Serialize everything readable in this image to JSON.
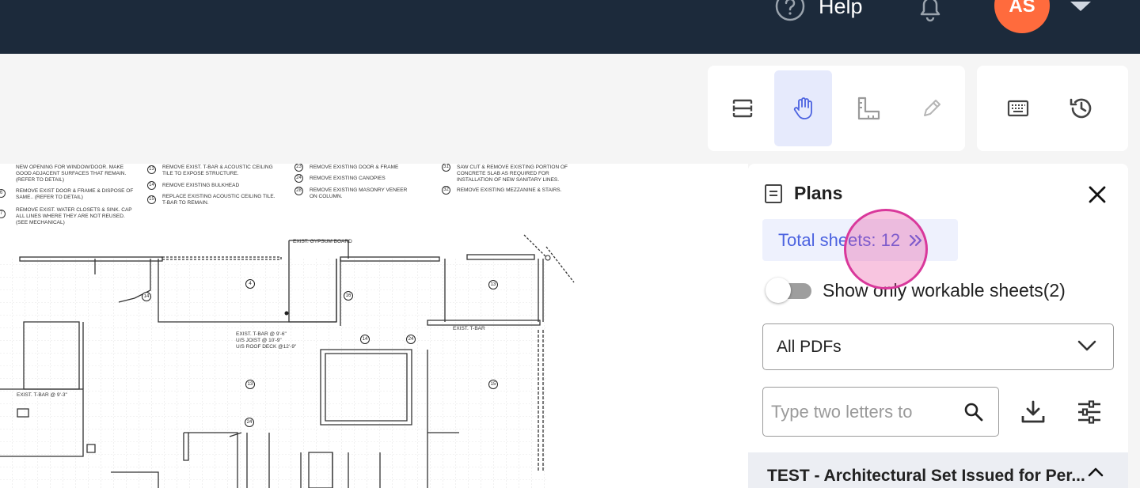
{
  "header": {
    "help_label": "Help",
    "avatar_initials": "AS",
    "colors": {
      "bar": "#1c2a3b",
      "avatar": "#ff6b3d"
    }
  },
  "toolbar": {
    "tools": [
      {
        "icon": "split-view-icon",
        "active": false
      },
      {
        "icon": "hand-pan-icon",
        "active": true
      },
      {
        "icon": "ruler-measure-icon",
        "active": false
      },
      {
        "icon": "pencil-markup-icon",
        "active": false
      }
    ],
    "side_tools": [
      {
        "icon": "keyboard-icon"
      },
      {
        "icon": "history-icon"
      }
    ]
  },
  "drawing": {
    "legend": [
      {
        "text": "NEW OPENING FOR WINDOW/DOOR. MAKE GOOD ADJACENT SURFACES THAT REMAIN.(REFER TO DETAIL)"
      },
      {
        "num": "6",
        "text": "REMOVE EXIST DOOR & FRAME & DISPOSE OF SAME.. (REFER TO DETAIL)"
      },
      {
        "num": "7",
        "text": "REMOVE EXIST. WATER CLOSETS & SINK. CAP ALL LINES WHERE THEY ARE NOT REUSED. (SEE MECHANICAL)"
      },
      {
        "num": "13",
        "text": "REMOVE EXIST. T-BAR & ACOUSTIC CEILING TILE TO EXPOSE STRUCTURE."
      },
      {
        "num": "14",
        "text": "REMOVE EXISTING BULKHEAD"
      },
      {
        "num": "15",
        "text": "REPLACE EXISTING ACOUSTIC CEILING TILE. T-BAR TO REMAIN."
      },
      {
        "num": "23",
        "text": "REMOVE EXISTING DOOR & FRAME"
      },
      {
        "num": "24",
        "text": "REMOVE EXISTING CANOPIES"
      },
      {
        "num": "28",
        "text": "REMOVE EXISTING MASONRY VENEER ON COLUMN."
      },
      {
        "num": "31",
        "text": "SAW CUT & REMOVE EXISTING PORTION OF CONCRETE SLAB AS REQUIRED FOR INSTALLATION OF NEW SANITARY LINES."
      },
      {
        "num": "32",
        "text": "REMOVE EXISTING MEZZANINE & STAIRS."
      }
    ],
    "notes": {
      "gypsum": "EXIST. GYPSUM BOARD",
      "tbar_right": "EXIST. T-BAR",
      "tbar_center_1": "EXIST. T-BAR @ 9'-6\"",
      "tbar_center_2": "U/S JOIST @ 10'-9\"",
      "tbar_center_3": "U/S ROOF DECK @12'-9\"",
      "tbar_left": "EXIST. T-BAR @ 9'-3\""
    },
    "tags": [
      "14",
      "4",
      "16",
      "13",
      "14",
      "24",
      "13",
      "15",
      "24"
    ]
  },
  "plans_panel": {
    "title": "Plans",
    "total_sheets": "Total sheets: 12",
    "toggle_label": "Show only workable sheets(2)",
    "toggle_on": false,
    "select_value": "All PDFs",
    "search_placeholder": "Type two letters to",
    "set_title": "TEST - Architectural Set Issued for Per...",
    "accent": "#4c63e0"
  }
}
